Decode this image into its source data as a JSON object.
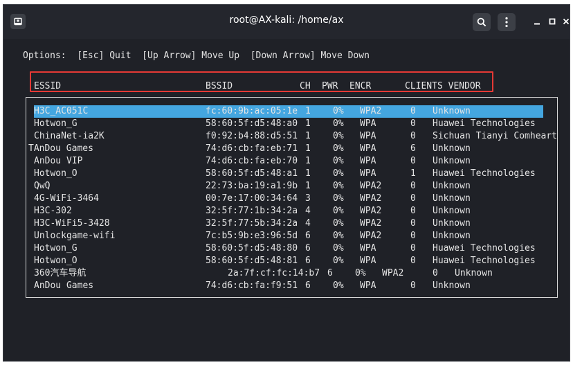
{
  "window": {
    "title": "root@AX-kali: /home/ax"
  },
  "icons": {
    "app": "terminal-tab-icon",
    "search": "search-icon",
    "menu": "kebab-menu-icon",
    "minimize": "minimize-icon",
    "maximize": "maximize-icon",
    "close": "close-icon"
  },
  "colors": {
    "terminal_bg": "#1f2127",
    "text": "#e5e5e5",
    "selection": "#44a6e0",
    "highlight_box": "#e53935"
  },
  "options_line": "Options:  [Esc] Quit  [Up Arrow] Move Up  [Down Arrow] Move Down",
  "columns": {
    "essid": "ESSID",
    "bssid": "BSSID",
    "ch": "CH",
    "pwr": "PWR",
    "encr": "ENCR",
    "clients_vendor": "CLIENTS VENDOR"
  },
  "selected_index": 0,
  "networks": [
    {
      "essid": "H3C_AC051C",
      "bssid": "fc:60:9b:ac:05:1e",
      "ch": "1",
      "pwr": "0%",
      "encr": "WPA2",
      "clients": "0",
      "vendor": "Unknown"
    },
    {
      "essid": "Hotwon_G",
      "bssid": "58:60:5f:d5:48:a0",
      "ch": "1",
      "pwr": "0%",
      "encr": "WPA",
      "clients": "0",
      "vendor": "Huawei Technologies"
    },
    {
      "essid": "ChinaNet-ia2K",
      "bssid": "f0:92:b4:88:d5:51",
      "ch": "1",
      "pwr": "0%",
      "encr": "WPA",
      "clients": "0",
      "vendor": "Sichuan Tianyi Comheart"
    },
    {
      "essid": "TAnDou Games",
      "bssid": "74:d6:cb:fa:eb:71",
      "ch": "1",
      "pwr": "0%",
      "encr": "WPA",
      "clients": "6",
      "vendor": "Unknown"
    },
    {
      "essid": "AnDou VIP",
      "bssid": "74:d6:cb:fa:eb:70",
      "ch": "1",
      "pwr": "0%",
      "encr": "WPA",
      "clients": "0",
      "vendor": "Unknown"
    },
    {
      "essid": "Hotwon_O",
      "bssid": "58:60:5f:d5:48:a1",
      "ch": "1",
      "pwr": "0%",
      "encr": "WPA",
      "clients": "1",
      "vendor": "Huawei Technologies"
    },
    {
      "essid": "QwQ",
      "bssid": "22:73:ba:19:a1:9b",
      "ch": "1",
      "pwr": "0%",
      "encr": "WPA2",
      "clients": "0",
      "vendor": "Unknown"
    },
    {
      "essid": "4G-WiFi-3464",
      "bssid": "00:7e:17:00:34:64",
      "ch": "3",
      "pwr": "0%",
      "encr": "WPA2",
      "clients": "0",
      "vendor": "Unknown"
    },
    {
      "essid": "H3C-302",
      "bssid": "32:5f:77:1b:34:2a",
      "ch": "4",
      "pwr": "0%",
      "encr": "WPA2",
      "clients": "0",
      "vendor": "Unknown"
    },
    {
      "essid": "H3C-WiFi5-3428",
      "bssid": "32:5f:77:5b:34:2a",
      "ch": "4",
      "pwr": "0%",
      "encr": "WPA2",
      "clients": "0",
      "vendor": "Unknown"
    },
    {
      "essid": "Unlockgame-wifi",
      "bssid": "7c:b5:9b:e3:96:5d",
      "ch": "6",
      "pwr": "0%",
      "encr": "WPA2",
      "clients": "0",
      "vendor": "Unknown"
    },
    {
      "essid": "Hotwon_G",
      "bssid": "58:60:5f:d5:48:80",
      "ch": "6",
      "pwr": "0%",
      "encr": "WPA",
      "clients": "0",
      "vendor": "Huawei Technologies"
    },
    {
      "essid": "Hotwon_O",
      "bssid": "58:60:5f:d5:48:81",
      "ch": "6",
      "pwr": "0%",
      "encr": "WPA",
      "clients": "0",
      "vendor": "Huawei Technologies"
    },
    {
      "essid": "360汽车导航",
      "bssid": "2a:7f:cf:fc:14:b7",
      "ch": "6",
      "pwr": "0%",
      "encr": "WPA2",
      "clients": "0",
      "vendor": "Unknown"
    },
    {
      "essid": "AnDou Games",
      "bssid": "74:d6:cb:fa:f9:51",
      "ch": "6",
      "pwr": "0%",
      "encr": "WPA",
      "clients": "0",
      "vendor": "Unknown"
    }
  ]
}
